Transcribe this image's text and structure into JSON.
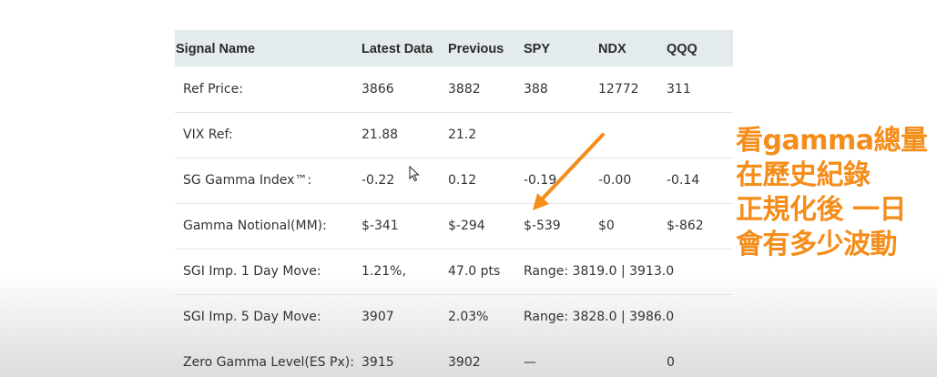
{
  "table": {
    "headers": [
      "Signal Name",
      "Latest Data",
      "Previous",
      "SPY",
      "NDX",
      "QQQ"
    ],
    "rows": [
      {
        "name": "Ref Price:",
        "latest": "3866",
        "previous": "3882",
        "spy": "388",
        "ndx": "12772",
        "qqq": "311"
      },
      {
        "name": "VIX Ref:",
        "latest": "21.88",
        "previous": "21.2",
        "spy": "",
        "ndx": "",
        "qqq": ""
      },
      {
        "name": "SG Gamma Index™:",
        "latest": "-0.22",
        "previous": "0.12",
        "spy": "-0.19",
        "ndx": "-0.00",
        "qqq": "-0.14"
      },
      {
        "name": "Gamma Notional(MM):",
        "latest": "$-341",
        "previous": "$-294",
        "spy": "$-539",
        "ndx": "$0",
        "qqq": "$-862"
      },
      {
        "name": "SGI Imp. 1 Day Move:",
        "latest": "1.21%,",
        "previous": "47.0 pts",
        "range": "Range: 3819.0 | 3913.0"
      },
      {
        "name": "SGI Imp. 5 Day Move:",
        "latest": "3907",
        "previous": "2.03%",
        "range": "Range: 3828.0 | 3986.0"
      },
      {
        "name": "Zero Gamma Level(ES Px):",
        "latest": "3915",
        "previous": "3902",
        "spy": "—",
        "ndx": "",
        "qqq": "0"
      }
    ]
  },
  "annotation": {
    "lines": [
      "看gamma總量",
      "在歷史紀錄",
      "正規化後 一日",
      "會有多少波動"
    ],
    "color": "#f58d1b"
  },
  "colors": {
    "header_bg": "#e4ebec",
    "row_border": "#e3e3e3",
    "arrow": "#f58d1b"
  }
}
